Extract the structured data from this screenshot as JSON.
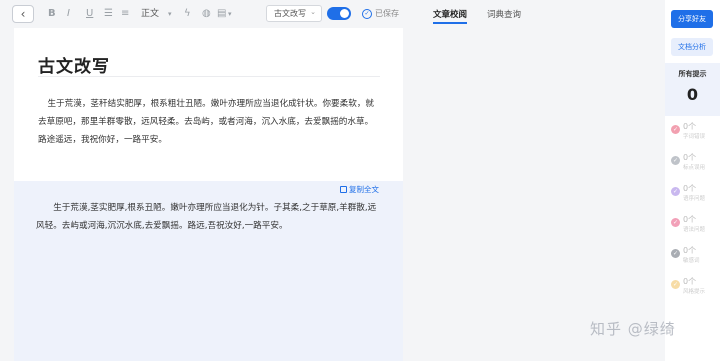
{
  "toolbar": {
    "back_icon": "‹",
    "bold": "B",
    "italic": "I",
    "underline": "U",
    "list_icon": "☰",
    "olist_icon": "≡",
    "text_style": "正文",
    "lightning_icon": "ϟ",
    "globe_icon": "◍",
    "format_icon": "▤",
    "mode_select": "古文改写",
    "toggle_on": true,
    "saved_label": "已保存"
  },
  "document": {
    "title": "古文改写",
    "source_text": "生于荒漠，茎秆结实肥厚，根系粗壮丑陋。嫩叶亦理所应当退化成针状。你要柔软，就去草原吧，那里羊群零散，远风轻柔。去岛屿，或者河海，沉入水底，去爱飘摇的水草。路途遥远，我祝你好，一路平安。",
    "copy_label": "复制全文",
    "result_text": "生于荒漠,茎实肥厚,根系丑陋。嫩叶亦理所应当退化为针。子其柔,之于草原,羊群散,远风轻。去屿或河海,沉沉水底,去爱飘摇。路远,吾祝汝好,一路平安。"
  },
  "tabs": [
    {
      "label": "文章校阅",
      "active": true
    },
    {
      "label": "词典查询",
      "active": false
    }
  ],
  "sidebar": {
    "share_label": "分享好友",
    "analysis_label": "文档分析",
    "hints_label": "所有提示",
    "hints_count": "0",
    "categories": [
      {
        "count": "0个",
        "label": "字词错误",
        "color": "#f2a0b0"
      },
      {
        "count": "0个",
        "label": "标点误用",
        "color": "#bfc3c9"
      },
      {
        "count": "0个",
        "label": "语序问题",
        "color": "#c9b8ef"
      },
      {
        "count": "0个",
        "label": "语法问题",
        "color": "#f2a0b8"
      },
      {
        "count": "0个",
        "label": "敏感词",
        "color": "#a9adb3"
      },
      {
        "count": "0个",
        "label": "风格提示",
        "color": "#f7dca6"
      }
    ]
  },
  "watermark": "知乎 @绿绮"
}
